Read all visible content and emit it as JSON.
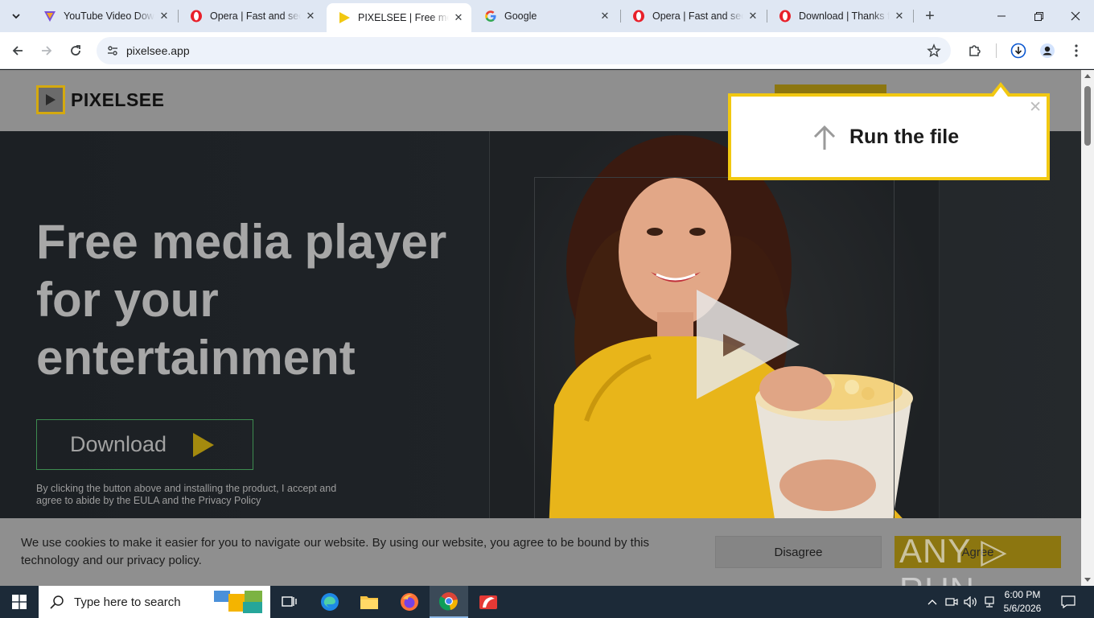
{
  "browser": {
    "tabs": [
      {
        "title": "YouTube Video Down",
        "favicon": "vpn-triangle-icon"
      },
      {
        "title": "Opera | Fast and secu",
        "favicon": "opera-icon"
      },
      {
        "title": "PIXELSEE | Free media",
        "favicon": "pixelsee-play-icon"
      },
      {
        "title": "Google",
        "favicon": "google-icon"
      },
      {
        "title": "Opera | Fast and secu",
        "favicon": "opera-icon"
      },
      {
        "title": "Download | Thanks fo",
        "favicon": "opera-icon"
      }
    ],
    "active_tab": 2,
    "url": "pixelsee.app"
  },
  "page": {
    "logo_text": "PIXELSEE",
    "hero_title": "Free media player for your entertainment",
    "download_label": "Download",
    "disclaimer": "By clicking the button above and installing the product, I accept and agree to abide by the EULA and the Privacy Policy",
    "popup_text": "Run the file",
    "cookie_text": "We use cookies to make it easier for you to navigate our website. By using our website, you agree to be bound by this technology and our privacy policy.",
    "disagree_label": "Disagree",
    "agree_label": "Agree",
    "watermark": "ANY ▷ RUN"
  },
  "taskbar": {
    "search_placeholder": "Type here to search",
    "time": "6:00 PM",
    "date": "5/6/2026"
  },
  "colors": {
    "accent_yellow": "#f2c811",
    "brand_gold": "#d4a90f",
    "download_border": "#3d8c50"
  }
}
